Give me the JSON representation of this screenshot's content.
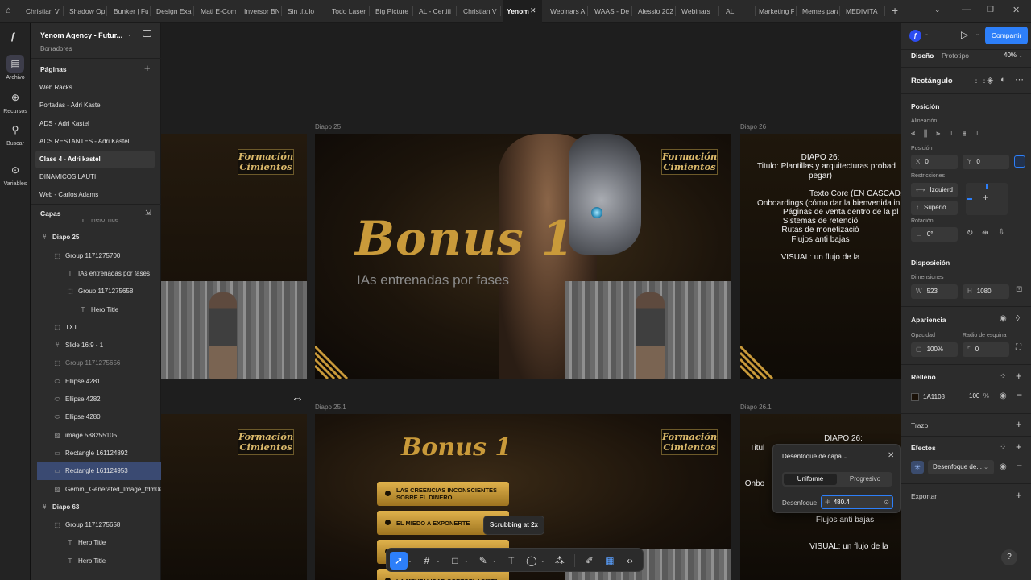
{
  "browser_tabs": [
    "Christian V",
    "Shadow Op",
    "Bunker | Fu",
    "Design Exa",
    "Mati E-Com",
    "Inversor BN",
    "Sin título",
    "Todo Laser",
    "Big Picture",
    "AL - Certifi",
    "Christian V",
    "Yenom",
    "Webinars A",
    "WAAS - De",
    "Alessio 202",
    "Webinars",
    "AL",
    "Marketing F",
    "Memes para",
    "MEDIVITA"
  ],
  "active_tab": "Yenom",
  "rail": {
    "archivo": "Archivo",
    "recursos": "Recursos",
    "buscar": "Buscar",
    "variables": "Variables"
  },
  "file": {
    "title": "Yenom Agency - Futur...",
    "subtitle": "Borradores"
  },
  "pages_header": "Páginas",
  "pages": [
    "Web Racks",
    "Portadas - Adri Kastel",
    "ADS - Adri Kastel",
    "ADS RESTANTES - Adri Kastel",
    "Clase 4 - Adri kastel",
    "DINAMICOS LAUTI",
    "Web - Carlos Adams"
  ],
  "layers_header": "Capas",
  "layers": [
    {
      "label": "Hero Title",
      "icon": "text-icon",
      "indent": 3
    },
    {
      "label": "Diapo 25",
      "icon": "frame-icon",
      "indent": 0
    },
    {
      "label": "Group 1171275700",
      "icon": "group-icon",
      "indent": 1
    },
    {
      "label": "IAs entrenadas por fases",
      "icon": "text-icon",
      "indent": 2
    },
    {
      "label": "Group 1171275658",
      "icon": "group-icon",
      "indent": 2
    },
    {
      "label": "Hero Title",
      "icon": "text-icon",
      "indent": 3
    },
    {
      "label": "TXT",
      "icon": "group-icon",
      "indent": 1
    },
    {
      "label": "Slide 16:9 - 1",
      "icon": "frame-icon",
      "indent": 1
    },
    {
      "label": "Group 1171275656",
      "icon": "group-icon",
      "indent": 1
    },
    {
      "label": "Ellipse 4281",
      "icon": "ellipse-icon",
      "indent": 1
    },
    {
      "label": "Ellipse 4282",
      "icon": "ellipse-icon",
      "indent": 1
    },
    {
      "label": "Ellipse 4280",
      "icon": "ellipse-icon",
      "indent": 1
    },
    {
      "label": "image 588255105",
      "icon": "image-icon",
      "indent": 1
    },
    {
      "label": "Rectangle 161124892",
      "icon": "rectangle-icon",
      "indent": 1
    },
    {
      "label": "Rectangle 161124953",
      "icon": "rectangle-icon",
      "indent": 1
    },
    {
      "label": "Gemini_Generated_Image_tdm0i8",
      "icon": "image-icon",
      "indent": 1
    },
    {
      "label": "Diapo 63",
      "icon": "frame-icon",
      "indent": 0
    },
    {
      "label": "Group 1171275658",
      "icon": "group-icon",
      "indent": 1
    },
    {
      "label": "Hero Title",
      "icon": "text-icon",
      "indent": 2
    },
    {
      "label": "Hero Title",
      "icon": "text-icon",
      "indent": 2
    }
  ],
  "canvas": {
    "frame_labels": {
      "d25": "Diapo 25",
      "d26": "Diapo 26",
      "d251": "Diapo 25.1",
      "d261": "Diapo 26.1"
    },
    "logo_line1": "Formación",
    "logo_line2": "Cimientos",
    "bonus_title": "Bonus 1",
    "bonus_subtitle": "IAs entrenadas por fases",
    "bonus_pills": [
      "LAS CREENCIAS INCONSCIENTES SOBRE EL DINERO",
      "EL MIEDO A EXPONERTE",
      "",
      "LA MENTALIDAD CORTOPLACISTA"
    ],
    "diapo26_lines": [
      "DIAPO 26:",
      "Titulo: Plantillas y arquitecturas probad",
      "pegar)",
      "",
      "Texto Core (EN CASCADA",
      "Onboardings (cómo dar la bienvenida inic",
      "Páginas de venta dentro de la pl",
      "Sistemas de retenció",
      "Rutas de monetizació",
      "Flujos anti bajas",
      "",
      "VISUAL: un flujo de la"
    ],
    "diapo261_lines": [
      "DIAPO 26:",
      "Titul",
      "Onbo",
      "Flujos anti bajas",
      "VISUAL: un flujo de la"
    ]
  },
  "blur_popup": {
    "title": "Desenfoque de capa",
    "tab_uniform": "Uniforme",
    "tab_progressive": "Progresivo",
    "label": "Desenfoque",
    "value": "480.4"
  },
  "tooltip": "Scrubbing at 2x",
  "right": {
    "share": "Compartir",
    "tab_design": "Diseño",
    "tab_prototype": "Prototipo",
    "zoom": "40%",
    "selection": "Rectángulo",
    "position": "Posición",
    "alignment": "Alineación",
    "position_label": "Posición",
    "x_label": "X",
    "x": "0",
    "y_label": "Y",
    "y": "0",
    "constraints": "Restricciones",
    "constraint_h": "Izquierd",
    "constraint_v": "Superio",
    "rotation": "Rotación",
    "rotation_value": "0°",
    "layout": "Disposición",
    "dimensions": "Dimensiones",
    "w_label": "W",
    "w": "523",
    "h_label": "H",
    "h": "1080",
    "appearance": "Apariencia",
    "opacity_label": "Opacidad",
    "opacity": "100%",
    "radius_label": "Radio de esquina",
    "radius": "0",
    "fill": "Relleno",
    "fill_hex": "1A1108",
    "fill_opacity": "100",
    "fill_pct": "%",
    "stroke": "Trazo",
    "effects": "Efectos",
    "effect_name": "Desenfoque de...",
    "export": "Exportar",
    "help": "?"
  },
  "colors": {
    "accent": "#2d7ff9",
    "gold": "#c99a3a",
    "fill": "#1a1108"
  }
}
